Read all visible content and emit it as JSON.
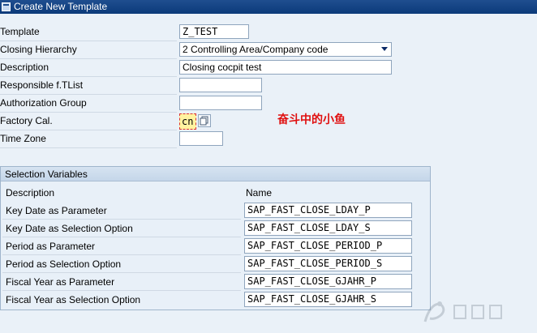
{
  "window": {
    "title": "Create New Template"
  },
  "form": {
    "template_label": "Template",
    "template_value": "Z_TEST",
    "closing_hierarchy_label": "Closing Hierarchy",
    "closing_hierarchy_value": "2 Controlling Area/Company code",
    "description_label": "Description",
    "description_value": "Closing cocpit test",
    "responsible_label": "Responsible f.TList",
    "responsible_value": "",
    "auth_group_label": "Authorization Group",
    "auth_group_value": "",
    "factory_cal_label": "Factory Cal.",
    "factory_cal_value": "cn",
    "time_zone_label": "Time Zone",
    "time_zone_value": ""
  },
  "annotation": {
    "text": "奋斗中的小鱼"
  },
  "selection_variables": {
    "title": "Selection Variables",
    "col_description": "Description",
    "col_name": "Name",
    "rows": [
      {
        "description": "Key Date as Parameter",
        "name": "SAP_FAST_CLOSE_LDAY_P"
      },
      {
        "description": "Key Date as Selection Option",
        "name": "SAP_FAST_CLOSE_LDAY_S"
      },
      {
        "description": "Period as Parameter",
        "name": "SAP_FAST_CLOSE_PERIOD_P"
      },
      {
        "description": "Period as Selection Option",
        "name": "SAP_FAST_CLOSE_PERIOD_S"
      },
      {
        "description": "Fiscal Year as Parameter",
        "name": "SAP_FAST_CLOSE_GJAHR_P"
      },
      {
        "description": "Fiscal Year as Selection Option",
        "name": "SAP_FAST_CLOSE_GJAHR_S"
      }
    ]
  },
  "colors": {
    "titlebar": "#0b3a7a",
    "annotation": "#e01010",
    "background": "#eaf1f8"
  },
  "icons": {
    "titlebar": "window-icon",
    "value_help": "value-help-icon",
    "dropdown": "chevron-down-icon",
    "watermark": "watermark-logo"
  }
}
